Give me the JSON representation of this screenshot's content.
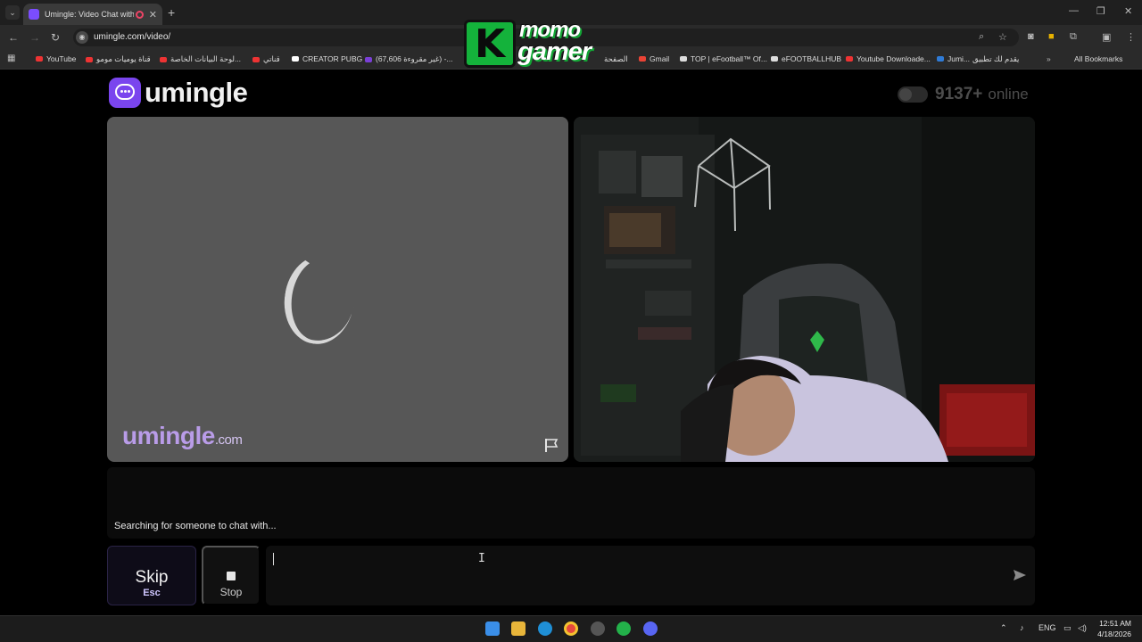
{
  "browser": {
    "tab_title": "Umingle: Video Chat with S",
    "url": "umingle.com/video/",
    "bookmarks": [
      "YouTube",
      "قناة يوميات مومو",
      "لوحة البيانات الخاصة...",
      "قناتي",
      "CREATOR PUBG",
      "(67,606 غير مقروءة) -...",
      "الصفحة",
      "Gmail",
      "TOP | eFootball™ Of...",
      "eFOOTBALLHUB",
      "Youtube Downloade...",
      "Jumi...",
      "يقدم لك تطبيق"
    ],
    "all_bookmarks": "All Bookmarks"
  },
  "overlay_logo": {
    "line1": "momo",
    "line2": "gamer"
  },
  "site": {
    "logo_text": "umingle",
    "online_count": "9137+",
    "online_label": "online",
    "watermark": "umingle",
    "watermark_suffix": ".com",
    "status": "Searching for someone to chat with...",
    "skip_label": "Skip",
    "skip_key": "Esc",
    "stop_label": "Stop",
    "message_value": ""
  },
  "taskbar": {
    "lang": "ENG",
    "time": "12:51 AM",
    "date": "4/18/2026"
  },
  "colors": {
    "brand_purple": "#7a45ee",
    "page_bg": "#000000",
    "stranger_bg": "#575757"
  }
}
